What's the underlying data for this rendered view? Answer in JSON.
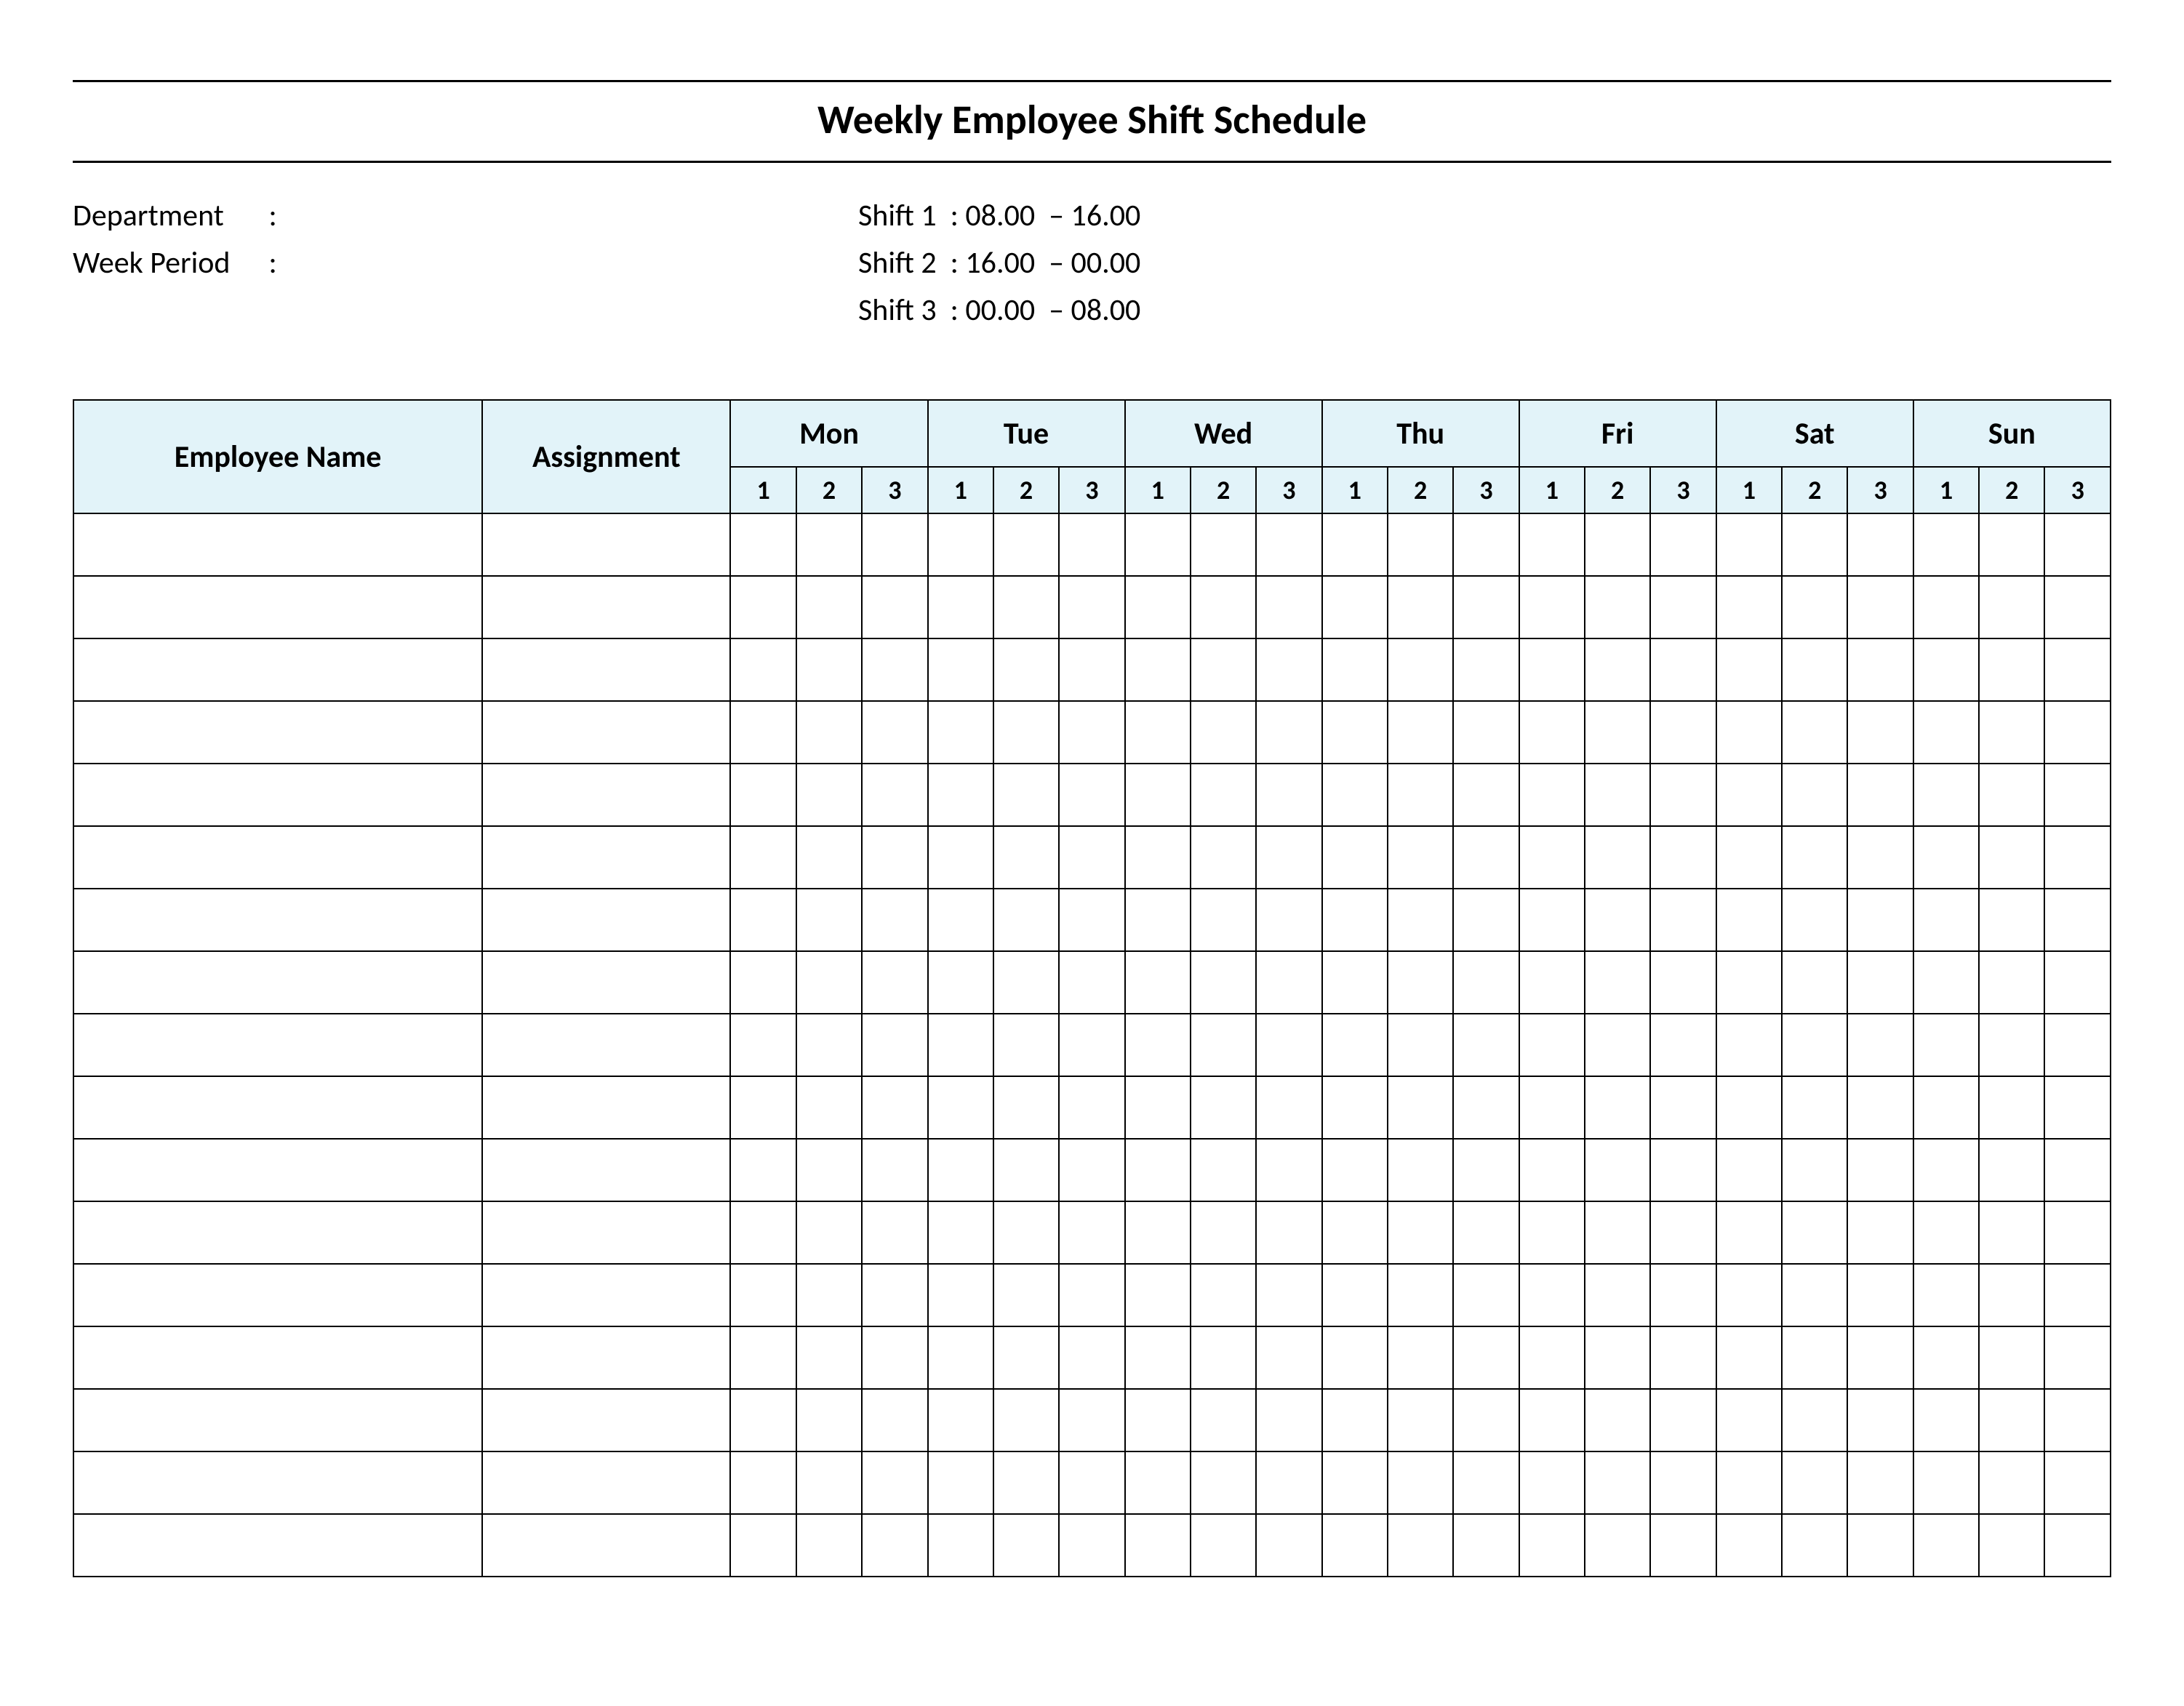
{
  "title": "Weekly Employee Shift Schedule",
  "meta": {
    "department_label": "Department",
    "department_value": "",
    "week_period_label": "Week  Period",
    "week_period_value": "",
    "shifts": [
      {
        "label": "Shift 1",
        "range": "08.00  – 16.00"
      },
      {
        "label": "Shift 2",
        "range": "16.00  – 00.00"
      },
      {
        "label": "Shift 3",
        "range": "00.00  – 08.00"
      }
    ]
  },
  "table": {
    "headers": {
      "employee": "Employee Name",
      "assignment": "Assignment",
      "days": [
        "Mon",
        "Tue",
        "Wed",
        "Thu",
        "Fri",
        "Sat",
        "Sun"
      ],
      "shift_nums": [
        "1",
        "2",
        "3"
      ]
    },
    "rows": [
      {
        "employee": "",
        "assignment": "",
        "cells": [
          "",
          "",
          "",
          "",
          "",
          "",
          "",
          "",
          "",
          "",
          "",
          "",
          "",
          "",
          "",
          "",
          "",
          "",
          "",
          "",
          ""
        ]
      },
      {
        "employee": "",
        "assignment": "",
        "cells": [
          "",
          "",
          "",
          "",
          "",
          "",
          "",
          "",
          "",
          "",
          "",
          "",
          "",
          "",
          "",
          "",
          "",
          "",
          "",
          "",
          ""
        ]
      },
      {
        "employee": "",
        "assignment": "",
        "cells": [
          "",
          "",
          "",
          "",
          "",
          "",
          "",
          "",
          "",
          "",
          "",
          "",
          "",
          "",
          "",
          "",
          "",
          "",
          "",
          "",
          ""
        ]
      },
      {
        "employee": "",
        "assignment": "",
        "cells": [
          "",
          "",
          "",
          "",
          "",
          "",
          "",
          "",
          "",
          "",
          "",
          "",
          "",
          "",
          "",
          "",
          "",
          "",
          "",
          "",
          ""
        ]
      },
      {
        "employee": "",
        "assignment": "",
        "cells": [
          "",
          "",
          "",
          "",
          "",
          "",
          "",
          "",
          "",
          "",
          "",
          "",
          "",
          "",
          "",
          "",
          "",
          "",
          "",
          "",
          ""
        ]
      },
      {
        "employee": "",
        "assignment": "",
        "cells": [
          "",
          "",
          "",
          "",
          "",
          "",
          "",
          "",
          "",
          "",
          "",
          "",
          "",
          "",
          "",
          "",
          "",
          "",
          "",
          "",
          ""
        ]
      },
      {
        "employee": "",
        "assignment": "",
        "cells": [
          "",
          "",
          "",
          "",
          "",
          "",
          "",
          "",
          "",
          "",
          "",
          "",
          "",
          "",
          "",
          "",
          "",
          "",
          "",
          "",
          ""
        ]
      },
      {
        "employee": "",
        "assignment": "",
        "cells": [
          "",
          "",
          "",
          "",
          "",
          "",
          "",
          "",
          "",
          "",
          "",
          "",
          "",
          "",
          "",
          "",
          "",
          "",
          "",
          "",
          ""
        ]
      },
      {
        "employee": "",
        "assignment": "",
        "cells": [
          "",
          "",
          "",
          "",
          "",
          "",
          "",
          "",
          "",
          "",
          "",
          "",
          "",
          "",
          "",
          "",
          "",
          "",
          "",
          "",
          ""
        ]
      },
      {
        "employee": "",
        "assignment": "",
        "cells": [
          "",
          "",
          "",
          "",
          "",
          "",
          "",
          "",
          "",
          "",
          "",
          "",
          "",
          "",
          "",
          "",
          "",
          "",
          "",
          "",
          ""
        ]
      },
      {
        "employee": "",
        "assignment": "",
        "cells": [
          "",
          "",
          "",
          "",
          "",
          "",
          "",
          "",
          "",
          "",
          "",
          "",
          "",
          "",
          "",
          "",
          "",
          "",
          "",
          "",
          ""
        ]
      },
      {
        "employee": "",
        "assignment": "",
        "cells": [
          "",
          "",
          "",
          "",
          "",
          "",
          "",
          "",
          "",
          "",
          "",
          "",
          "",
          "",
          "",
          "",
          "",
          "",
          "",
          "",
          ""
        ]
      },
      {
        "employee": "",
        "assignment": "",
        "cells": [
          "",
          "",
          "",
          "",
          "",
          "",
          "",
          "",
          "",
          "",
          "",
          "",
          "",
          "",
          "",
          "",
          "",
          "",
          "",
          "",
          ""
        ]
      },
      {
        "employee": "",
        "assignment": "",
        "cells": [
          "",
          "",
          "",
          "",
          "",
          "",
          "",
          "",
          "",
          "",
          "",
          "",
          "",
          "",
          "",
          "",
          "",
          "",
          "",
          "",
          ""
        ]
      },
      {
        "employee": "",
        "assignment": "",
        "cells": [
          "",
          "",
          "",
          "",
          "",
          "",
          "",
          "",
          "",
          "",
          "",
          "",
          "",
          "",
          "",
          "",
          "",
          "",
          "",
          "",
          ""
        ]
      },
      {
        "employee": "",
        "assignment": "",
        "cells": [
          "",
          "",
          "",
          "",
          "",
          "",
          "",
          "",
          "",
          "",
          "",
          "",
          "",
          "",
          "",
          "",
          "",
          "",
          "",
          "",
          ""
        ]
      },
      {
        "employee": "",
        "assignment": "",
        "cells": [
          "",
          "",
          "",
          "",
          "",
          "",
          "",
          "",
          "",
          "",
          "",
          "",
          "",
          "",
          "",
          "",
          "",
          "",
          "",
          "",
          ""
        ]
      }
    ]
  }
}
